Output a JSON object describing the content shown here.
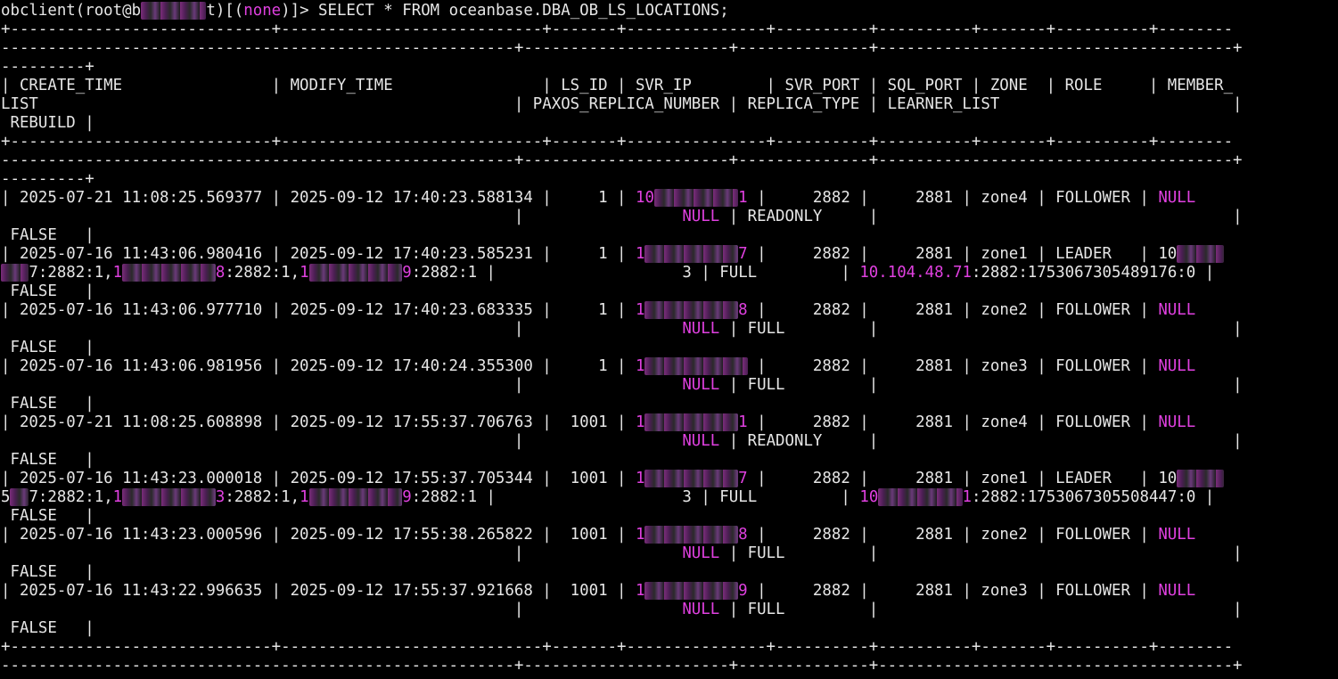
{
  "terminal": {
    "lines": [
      [
        {
          "t": "obclient(root@b"
        },
        {
          "t": "i      ",
          "m": true
        },
        {
          "t": "t)[("
        },
        {
          "t": "none",
          "c": "magenta"
        },
        {
          "t": ")]> SELECT * FROM oceanbase.DBA_OB_LS_LOCATIONS;"
        }
      ],
      [
        {
          "t": "+----------------------------+----------------------------+-------+---------------+----------+----------+-------+----------+--------"
        }
      ],
      [
        {
          "t": "-------------------------------------------------------+----------------------+--------------+--------------------------------------+"
        }
      ],
      [
        {
          "t": "---------+"
        }
      ],
      [
        {
          "t": "| CREATE_TIME                | MODIFY_TIME                | LS_ID | SVR_IP        | SVR_PORT | SQL_PORT | ZONE  | ROLE     | MEMBER_"
        }
      ],
      [
        {
          "t": "LIST                                                   | PAXOS_REPLICA_NUMBER | REPLICA_TYPE | LEARNER_LIST                         |"
        }
      ],
      [
        {
          "t": " REBUILD |"
        }
      ],
      [
        {
          "t": "+----------------------------+----------------------------+-------+---------------+----------+----------+-------+----------+--------"
        }
      ],
      [
        {
          "t": "-------------------------------------------------------+----------------------+--------------+--------------------------------------+"
        }
      ],
      [
        {
          "t": "---------+"
        }
      ],
      [
        {
          "t": "| 2025-07-21 11:08:25.569377 | 2025-09-12 17:40:23.588134 |     1 | "
        },
        {
          "t": "10",
          "c": "magenta"
        },
        {
          "t": "         ",
          "m": true
        },
        {
          "t": "1",
          "c": "magenta"
        },
        {
          "t": " |     2882 |     2881 | zone4 | FOLLOWER | "
        },
        {
          "t": "NULL",
          "c": "magenta"
        }
      ],
      [
        {
          "t": "                                                       |                 "
        },
        {
          "t": "NULL",
          "c": "magenta"
        },
        {
          "t": " | READONLY     |                                      |"
        }
      ],
      [
        {
          "t": " FALSE   |"
        }
      ],
      [
        {
          "t": "| 2025-07-16 11:43:06.980416 | 2025-09-12 17:40:23.585231 |     1 | "
        },
        {
          "t": "1",
          "c": "magenta"
        },
        {
          "t": "          ",
          "m": true
        },
        {
          "t": "7",
          "c": "magenta"
        },
        {
          "t": " |     2882 |     2881 | zone1 | LEADER   | 10"
        },
        {
          "t": "     ",
          "m": true
        }
      ],
      [
        {
          "t": "   ",
          "m": true
        },
        {
          "t": "7:2882:1,"
        },
        {
          "t": "1",
          "c": "magenta"
        },
        {
          "t": "          ",
          "m": true
        },
        {
          "t": "8",
          "c": "magenta"
        },
        {
          "t": ":2882:1,"
        },
        {
          "t": "1",
          "c": "magenta"
        },
        {
          "t": "          ",
          "m": true
        },
        {
          "t": "9",
          "c": "magenta"
        },
        {
          "t": ":2882:1 |                    3 | FULL         | "
        },
        {
          "t": "10.104.48.71",
          "c": "magenta"
        },
        {
          "t": ":2882:1753067305489176:0 |"
        }
      ],
      [
        {
          "t": " FALSE   |"
        }
      ],
      [
        {
          "t": "| 2025-07-16 11:43:06.977710 | 2025-09-12 17:40:23.683335 |     1 | "
        },
        {
          "t": "1",
          "c": "magenta"
        },
        {
          "t": "          ",
          "m": true
        },
        {
          "t": "8",
          "c": "magenta"
        },
        {
          "t": " |     2882 |     2881 | zone2 | FOLLOWER | "
        },
        {
          "t": "NULL",
          "c": "magenta"
        }
      ],
      [
        {
          "t": "                                                       |                 "
        },
        {
          "t": "NULL",
          "c": "magenta"
        },
        {
          "t": " | FULL         |                                      |"
        }
      ],
      [
        {
          "t": " FALSE   |"
        }
      ],
      [
        {
          "t": "| 2025-07-16 11:43:06.981956 | 2025-09-12 17:40:24.355300 |     1 | "
        },
        {
          "t": "1",
          "c": "magenta"
        },
        {
          "t": "           ",
          "m": true
        },
        {
          "t": " |     2882 |     2881 | zone3 | FOLLOWER | "
        },
        {
          "t": "NULL",
          "c": "magenta"
        }
      ],
      [
        {
          "t": "                                                       |                 "
        },
        {
          "t": "NULL",
          "c": "magenta"
        },
        {
          "t": " | FULL         |                                      |"
        }
      ],
      [
        {
          "t": " FALSE   |"
        }
      ],
      [
        {
          "t": "| 2025-07-21 11:08:25.608898 | 2025-09-12 17:55:37.706763 |  1001 | "
        },
        {
          "t": "1",
          "c": "magenta"
        },
        {
          "t": "          ",
          "m": true
        },
        {
          "t": "1",
          "c": "magenta"
        },
        {
          "t": " |     2882 |     2881 | zone4 | FOLLOWER | "
        },
        {
          "t": "NULL",
          "c": "magenta"
        }
      ],
      [
        {
          "t": "                                                       |                 "
        },
        {
          "t": "NULL",
          "c": "magenta"
        },
        {
          "t": " | READONLY     |                                      |"
        }
      ],
      [
        {
          "t": " FALSE   |"
        }
      ],
      [
        {
          "t": "| 2025-07-16 11:43:23.000018 | 2025-09-12 17:55:37.705344 |  1001 | "
        },
        {
          "t": "1",
          "c": "magenta"
        },
        {
          "t": "          ",
          "m": true
        },
        {
          "t": "7",
          "c": "magenta"
        },
        {
          "t": " |     2882 |     2881 | zone1 | LEADER   | 10"
        },
        {
          "t": "     ",
          "m": true
        }
      ],
      [
        {
          "t": "5"
        },
        {
          "t": "  ",
          "m": true
        },
        {
          "t": "7:2882:1,"
        },
        {
          "t": "1",
          "c": "magenta"
        },
        {
          "t": "          ",
          "m": true
        },
        {
          "t": "3",
          "c": "magenta"
        },
        {
          "t": ":2882:1,"
        },
        {
          "t": "1",
          "c": "magenta"
        },
        {
          "t": "          ",
          "m": true
        },
        {
          "t": "9",
          "c": "magenta"
        },
        {
          "t": ":2882:1 |                    3 | FULL         | "
        },
        {
          "t": "10",
          "c": "magenta"
        },
        {
          "t": "         ",
          "m": true
        },
        {
          "t": "1",
          "c": "magenta"
        },
        {
          "t": ":2882:1753067305508447:0 |"
        }
      ],
      [
        {
          "t": " FALSE   |"
        }
      ],
      [
        {
          "t": "| 2025-07-16 11:43:23.000596 | 2025-09-12 17:55:38.265822 |  1001 | "
        },
        {
          "t": "1",
          "c": "magenta"
        },
        {
          "t": "          ",
          "m": true
        },
        {
          "t": "8",
          "c": "magenta"
        },
        {
          "t": " |     2882 |     2881 | zone2 | FOLLOWER | "
        },
        {
          "t": "NULL",
          "c": "magenta"
        }
      ],
      [
        {
          "t": "                                                       |                 "
        },
        {
          "t": "NULL",
          "c": "magenta"
        },
        {
          "t": " | FULL         |                                      |"
        }
      ],
      [
        {
          "t": " FALSE   |"
        }
      ],
      [
        {
          "t": "| 2025-07-16 11:43:22.996635 | 2025-09-12 17:55:37.921668 |  1001 | "
        },
        {
          "t": "1",
          "c": "magenta"
        },
        {
          "t": "          ",
          "m": true
        },
        {
          "t": "9",
          "c": "magenta"
        },
        {
          "t": " |     2882 |     2881 | zone3 | FOLLOWER | "
        },
        {
          "t": "NULL",
          "c": "magenta"
        }
      ],
      [
        {
          "t": "                                                       |                 "
        },
        {
          "t": "NULL",
          "c": "magenta"
        },
        {
          "t": " | FULL         |                                      |"
        }
      ],
      [
        {
          "t": " FALSE   |"
        }
      ],
      [
        {
          "t": "+----------------------------+----------------------------+-------+---------------+----------+----------+-------+----------+--------"
        }
      ],
      [
        {
          "t": "-------------------------------------------------------+----------------------+--------------+--------------------------------------+"
        }
      ]
    ]
  }
}
